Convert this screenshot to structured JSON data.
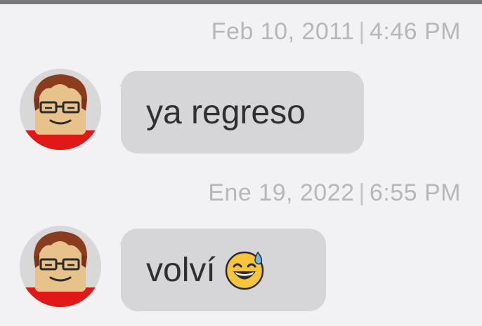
{
  "messages": [
    {
      "date": "Feb 10, 2011",
      "time": "4:46 PM",
      "text": "ya regreso",
      "avatar_icon": "roblox-avatar"
    },
    {
      "date": "Ene 19, 2022",
      "time": "6:55 PM",
      "text": "volví",
      "emoji": "sweat-smile-emoji",
      "avatar_icon": "roblox-avatar"
    }
  ],
  "separator": "|",
  "colors": {
    "background": "#f2f2f4",
    "bubble": "#d6d6d8",
    "timestamp": "#b7b7b9",
    "text": "#2f3033"
  }
}
